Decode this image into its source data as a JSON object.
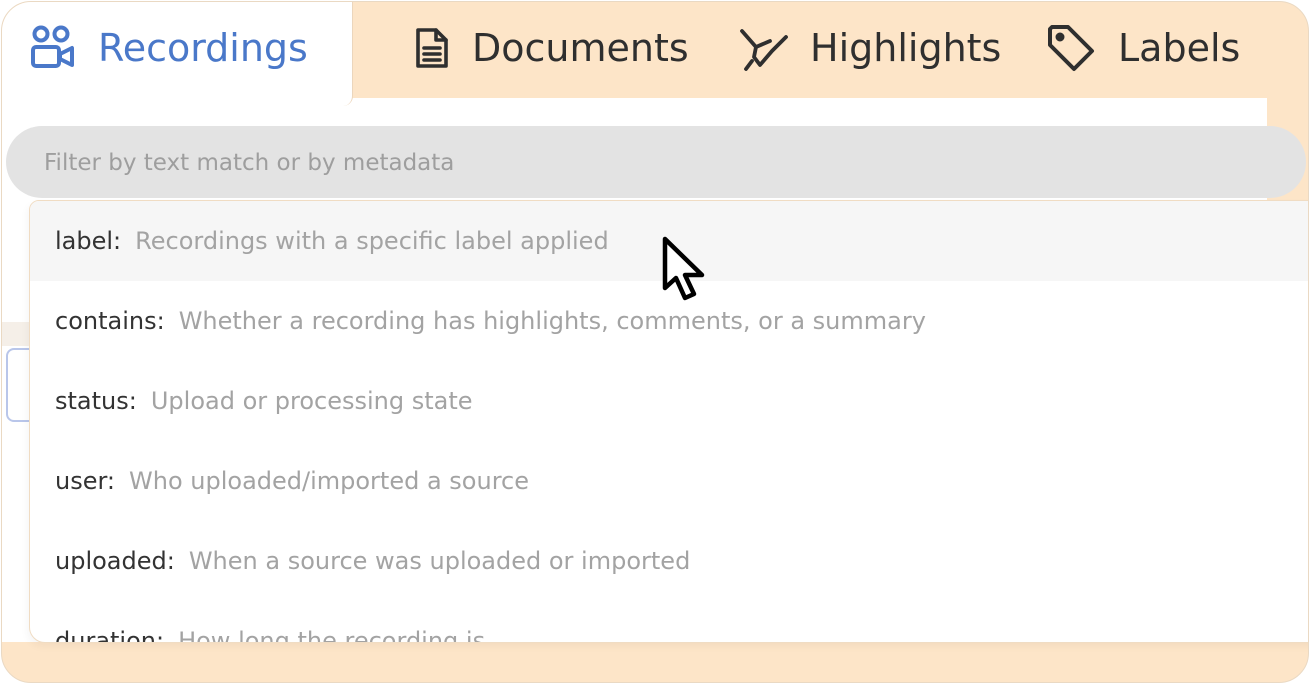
{
  "tabs": [
    {
      "label": "Recordings",
      "icon": "users-video-icon",
      "active": true
    },
    {
      "label": "Documents",
      "icon": "document-icon",
      "active": false
    },
    {
      "label": "Highlights",
      "icon": "highlighter-icon",
      "active": false
    },
    {
      "label": "Labels",
      "icon": "tag-icon",
      "active": false
    }
  ],
  "filter": {
    "placeholder": "Filter by text match or by metadata"
  },
  "filter_options": [
    {
      "key": "label:",
      "description": "Recordings with a specific label applied"
    },
    {
      "key": "contains:",
      "description": "Whether a recording has highlights, comments, or a summary"
    },
    {
      "key": "status:",
      "description": "Upload or processing state"
    },
    {
      "key": "user:",
      "description": "Who uploaded/imported a source"
    },
    {
      "key": "uploaded:",
      "description": "When a source was uploaded or imported"
    },
    {
      "key": "duration:",
      "description": "How long the recording is"
    }
  ],
  "colors": {
    "accent": "#4a78c9",
    "frame": "#fde5c8",
    "hover_row": "#f6f6f6"
  }
}
